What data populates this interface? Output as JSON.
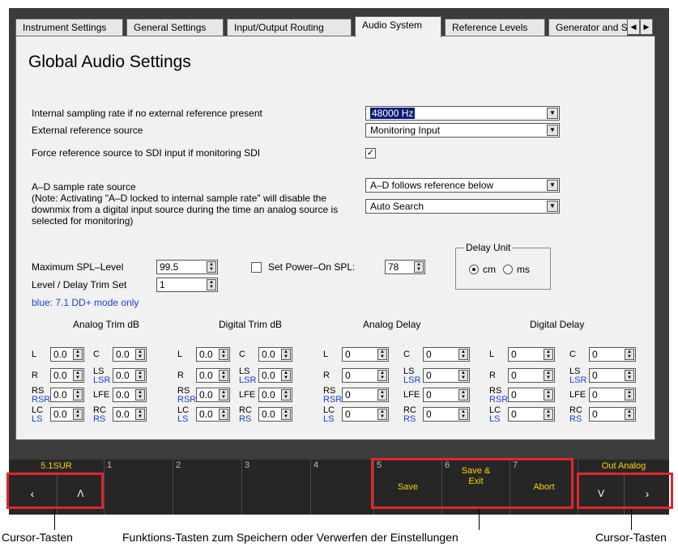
{
  "tabs": [
    "Instrument Settings",
    "General Settings",
    "Input/Output Routing",
    "Audio System",
    "Reference Levels",
    "Generator and S"
  ],
  "active_tab": "Audio System",
  "page_title": "Global Audio Settings",
  "settings": {
    "sampling_label": "Internal sampling rate if no external reference present",
    "sampling_value": "48000 Hz",
    "ext_ref_label": "External reference source",
    "ext_ref_value": "Monitoring Input",
    "force_label": "Force reference source to SDI input if monitoring SDI",
    "force_checked": true,
    "ad_label": "A–D sample rate source",
    "ad_note": "(Note: Activating \"A–D locked to internal sample rate\" will disable the downmix from a digital input source during the time an analog source is selected for monitoring)",
    "ad_value": "A–D follows reference below",
    "ad_value2": "Auto Search"
  },
  "spl": {
    "max_label": "Maximum SPL–Level",
    "max_value": "99.5",
    "trimset_label": "Level / Delay Trim Set",
    "trimset_value": "1",
    "poweron_label": "Set Power–On SPL:",
    "poweron_checked": false,
    "poweron_value": "78",
    "blue_note": "blue: 7.1 DD+ mode only"
  },
  "delay_unit": {
    "legend": "Delay Unit",
    "options": [
      "cm",
      "ms"
    ],
    "selected": "cm"
  },
  "trim": {
    "headers": [
      "Analog Trim dB",
      "Digital Trim dB",
      "Analog Delay",
      "Digital Delay"
    ],
    "left_channels": [
      {
        "main": "L",
        "sub": ""
      },
      {
        "main": "R",
        "sub": ""
      },
      {
        "main": "RS",
        "sub": "RSR"
      },
      {
        "main": "LC",
        "sub": "LS"
      }
    ],
    "right_channels": [
      {
        "main": "C",
        "sub": ""
      },
      {
        "main": "LS",
        "sub": "LSR"
      },
      {
        "main": "LFE",
        "sub": ""
      },
      {
        "main": "RC",
        "sub": "RS"
      }
    ],
    "trim_value": "0.0",
    "delay_value": "0"
  },
  "softkeys": {
    "left_label": "5.1SUR",
    "right_label": "Out Analog",
    "left_arrow": "‹",
    "up_arrow": "Λ",
    "down_arrow": "V",
    "right_arrow": "›",
    "nums": [
      "1",
      "2",
      "3",
      "4",
      "5",
      "6",
      "7"
    ],
    "save": "Save",
    "save_exit": "Save & Exit",
    "abort": "Abort"
  },
  "captions": {
    "left": "Cursor-Tasten",
    "middle": "Funktions-Tasten zum Speichern oder Verwerfen der Einstellungen",
    "right": "Cursor-Tasten"
  },
  "colors": {
    "highlight_red": "#e1262b",
    "softkey_text": "#ffd000",
    "blue_text": "#1c3fd8"
  }
}
